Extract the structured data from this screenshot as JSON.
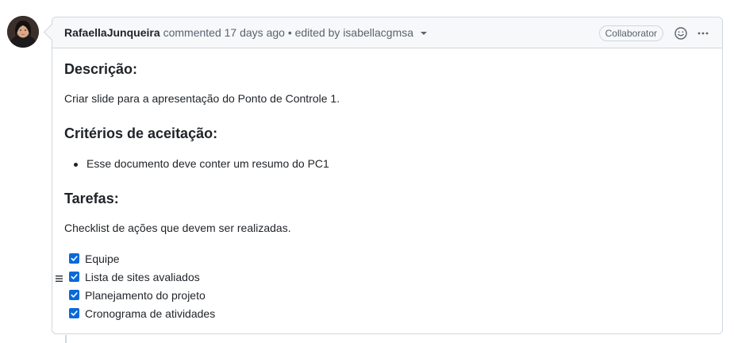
{
  "comment": {
    "author": "RafaellaJunqueira",
    "meta_text": "commented 17 days ago • edited by isabellacgmsa",
    "role_badge": "Collaborator",
    "icons": {
      "avatar": "avatar",
      "menu_caret": "chevron-down-icon",
      "reaction": "smiley-icon",
      "more": "kebab-horizontal-icon",
      "drag": "grabber-icon",
      "check": "check-icon"
    },
    "accent_color": "#0969da"
  },
  "content": {
    "h_descricao": "Descrição:",
    "descricao_text": "Criar slide para a apresentação do Ponto de Controle 1.",
    "h_criterios": "Critérios de aceitação:",
    "criterios_items": [
      "Esse documento deve conter um resumo do PC1"
    ],
    "h_tarefas": "Tarefas:",
    "tarefas_text": "Checklist de ações que devem ser realizadas.",
    "tasks": [
      {
        "label": "Equipe",
        "checked": true
      },
      {
        "label": "Lista de sites avaliados",
        "checked": true
      },
      {
        "label": "Planejamento do projeto",
        "checked": true
      },
      {
        "label": "Cronograma de atividades",
        "checked": true
      }
    ]
  }
}
